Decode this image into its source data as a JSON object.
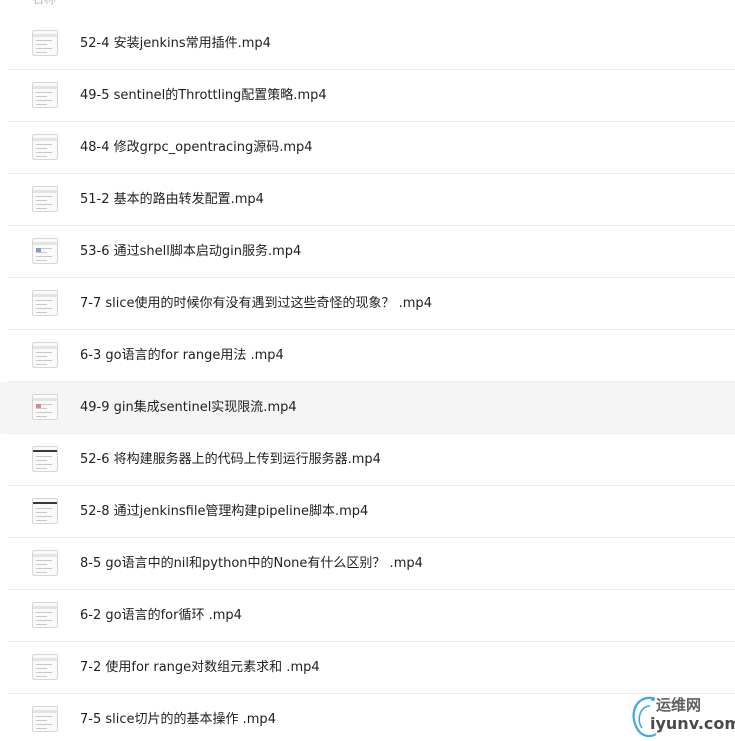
{
  "header": {
    "name_column": "名称"
  },
  "files": [
    {
      "name": "52-4 安装jenkins常用插件.mp4",
      "thumb": "light"
    },
    {
      "name": "49-5 sentinel的Throttling配置策略.mp4",
      "thumb": "light"
    },
    {
      "name": "48-4 修改grpc_opentracing源码.mp4",
      "thumb": "light"
    },
    {
      "name": "51-2 基本的路由转发配置.mp4",
      "thumb": "light"
    },
    {
      "name": "53-6 通过shell脚本启动gin服务.mp4",
      "thumb": "blue"
    },
    {
      "name": "7-7 slice使用的时候你有没有遇到过这些奇怪的现象？ .mp4",
      "thumb": "light"
    },
    {
      "name": "6-3 go语言的for range用法 .mp4",
      "thumb": "light"
    },
    {
      "name": "49-9 gin集成sentinel实现限流.mp4",
      "thumb": "red"
    },
    {
      "name": "52-6 将构建服务器上的代码上传到运行服务器.mp4",
      "thumb": "dark"
    },
    {
      "name": "52-8 通过jenkinsfile管理构建pipeline脚本.mp4",
      "thumb": "dark"
    },
    {
      "name": "8-5 go语言中的nil和python中的None有什么区别？ .mp4",
      "thumb": "light"
    },
    {
      "name": "6-2 go语言的for循环 .mp4",
      "thumb": "light"
    },
    {
      "name": "7-2 使用for range对数组元素求和 .mp4",
      "thumb": "light"
    },
    {
      "name": "7-5 slice切片的的基本操作 .mp4",
      "thumb": "light"
    }
  ],
  "hovered_index": 7,
  "watermark": {
    "line1": "运维网",
    "line2": "iyunv.com"
  }
}
